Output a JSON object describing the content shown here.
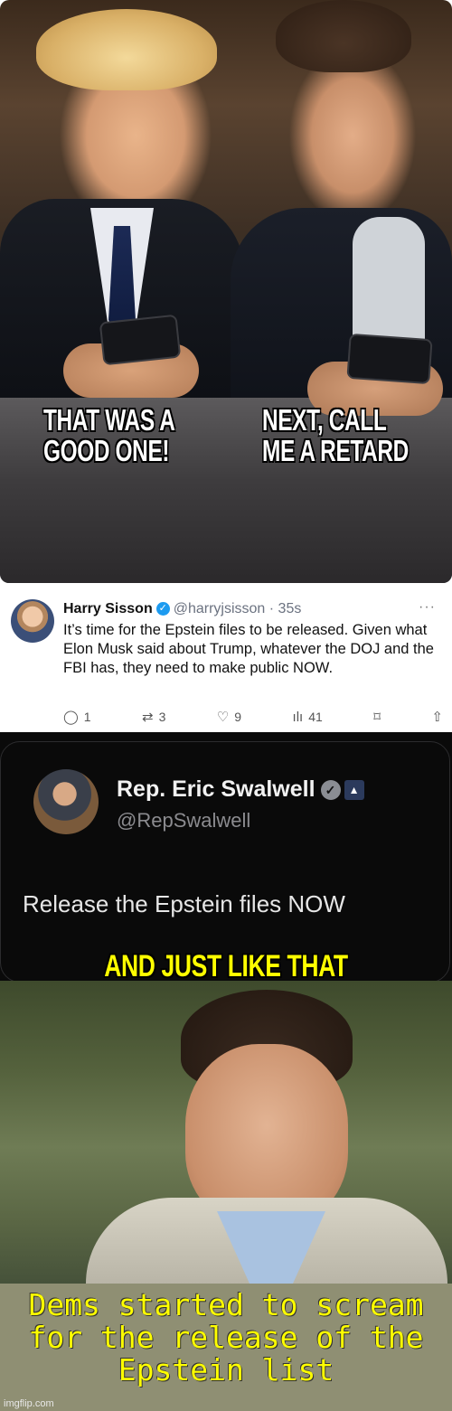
{
  "meme_top": {
    "caption_left": "THAT WAS A\nGOOD ONE!",
    "caption_right": "NEXT, CALL\nME A RETARD"
  },
  "tweet1": {
    "name": "Harry Sisson",
    "handle": "@harryjsisson",
    "time": "· 35s",
    "more": "···",
    "text": "It’s time for the Epstein files to be released. Given what Elon Musk said about Trump, whatever the DOJ and the FBI has, they need to make public NOW.",
    "replies": "1",
    "reposts": "3",
    "likes": "9",
    "views": "41",
    "icons": [
      "reply-icon",
      "repost-icon",
      "like-icon",
      "views-icon",
      "bookmark-icon",
      "share-icon"
    ]
  },
  "tweet2": {
    "name": "Rep. Eric Swalwell",
    "handle": "@RepSwalwell",
    "text": "Release the Epstein files NOW"
  },
  "meme_bottom": {
    "top_caption": "AND JUST LIKE THAT",
    "bottom_caption": "Dems started to scream for the release of the Epstein list",
    "watermark": "imgflip.com"
  },
  "colors": {
    "caption_yellow": "#ffff00",
    "verified_blue": "#1d9bf0",
    "band_bg": "#8f8f73"
  }
}
